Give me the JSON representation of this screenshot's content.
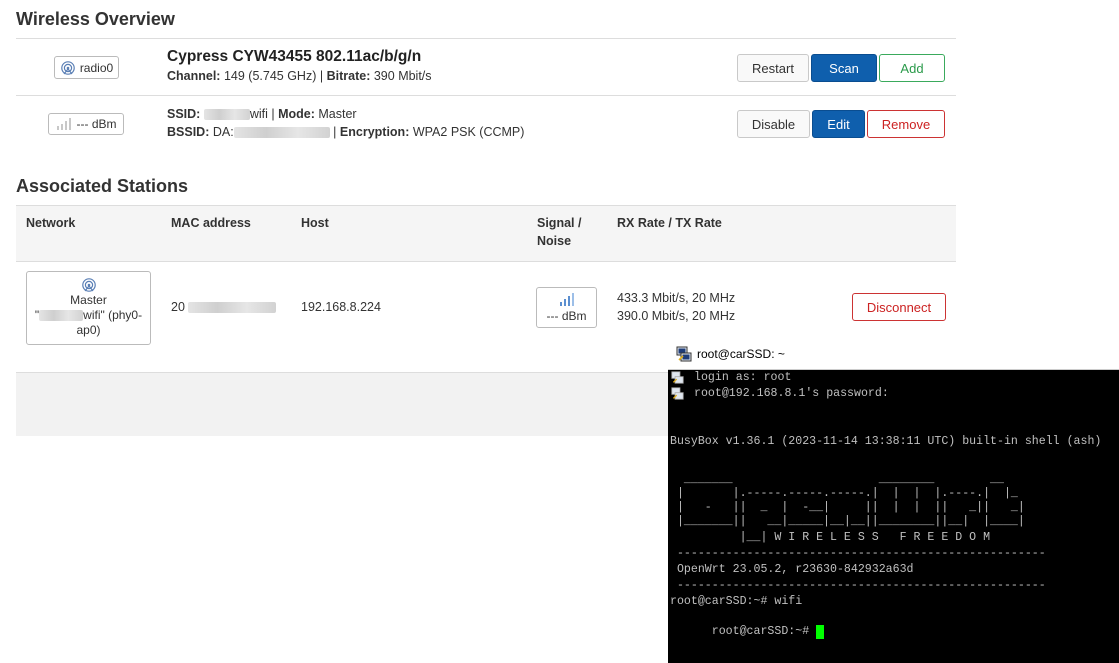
{
  "wireless_overview": {
    "title": "Wireless Overview",
    "radio": {
      "badge_label": "radio0",
      "device_name": "Cypress CYW43455 802.11ac/b/g/n",
      "channel_label": "Channel:",
      "channel_value": "149 (5.745 GHz)",
      "separator": "|",
      "bitrate_label": "Bitrate:",
      "bitrate_value": "390 Mbit/s",
      "buttons": {
        "restart": "Restart",
        "scan": "Scan",
        "add": "Add"
      }
    },
    "network": {
      "badge_label": "--- dBm",
      "ssid_label": "SSID:",
      "ssid_suffix": "wifi",
      "mode_label": "Mode:",
      "mode_value": "Master",
      "bssid_label": "BSSID:",
      "bssid_prefix": "DA:",
      "encryption_label": "Encryption:",
      "encryption_value": "WPA2 PSK (CCMP)",
      "buttons": {
        "disable": "Disable",
        "edit": "Edit",
        "remove": "Remove"
      }
    }
  },
  "associated_stations": {
    "title": "Associated Stations",
    "columns": [
      "Network",
      "MAC address",
      "Host",
      "Signal /",
      "Noise",
      "RX Rate / TX Rate"
    ],
    "rows": [
      {
        "network_line1": "Master",
        "network_quote_open": "\"",
        "network_ssid_suffix": "wifi\" (phy0-",
        "network_line3": "ap0)",
        "mac_prefix": "20",
        "host": "192.168.8.224",
        "signal": "--- dBm",
        "rx_rate": "433.3 Mbit/s, 20 MHz",
        "tx_rate": "390.0 Mbit/s, 20 MHz",
        "disconnect": "Disconnect"
      }
    ]
  },
  "terminal": {
    "title": "root@carSSD: ~",
    "lines": [
      "login as: root",
      "root@192.168.8.1's password:",
      "BusyBox v1.36.1 (2023-11-14 13:38:11 UTC) built-in shell (ash)",
      "  _______                     ________        __",
      " |       |.-----.-----.-----.|  |  |  |.----.|  |_",
      " |   -   ||  _  |  -__|     ||  |  |  ||   _||   _|",
      " |_______||   __|_____|__|__||________||__|  |____|",
      "          |__| W I R E L E S S   F R E E D O M",
      " -----------------------------------------------------",
      " OpenWrt 23.05.2, r23630-842932a63d",
      " -----------------------------------------------------",
      "root@carSSD:~# wifi",
      "root@carSSD:~# "
    ]
  },
  "colors": {
    "primary": "#0f5fad",
    "success": "#2a9a4a",
    "danger": "#cc2222",
    "cursor": "#00ff00"
  }
}
